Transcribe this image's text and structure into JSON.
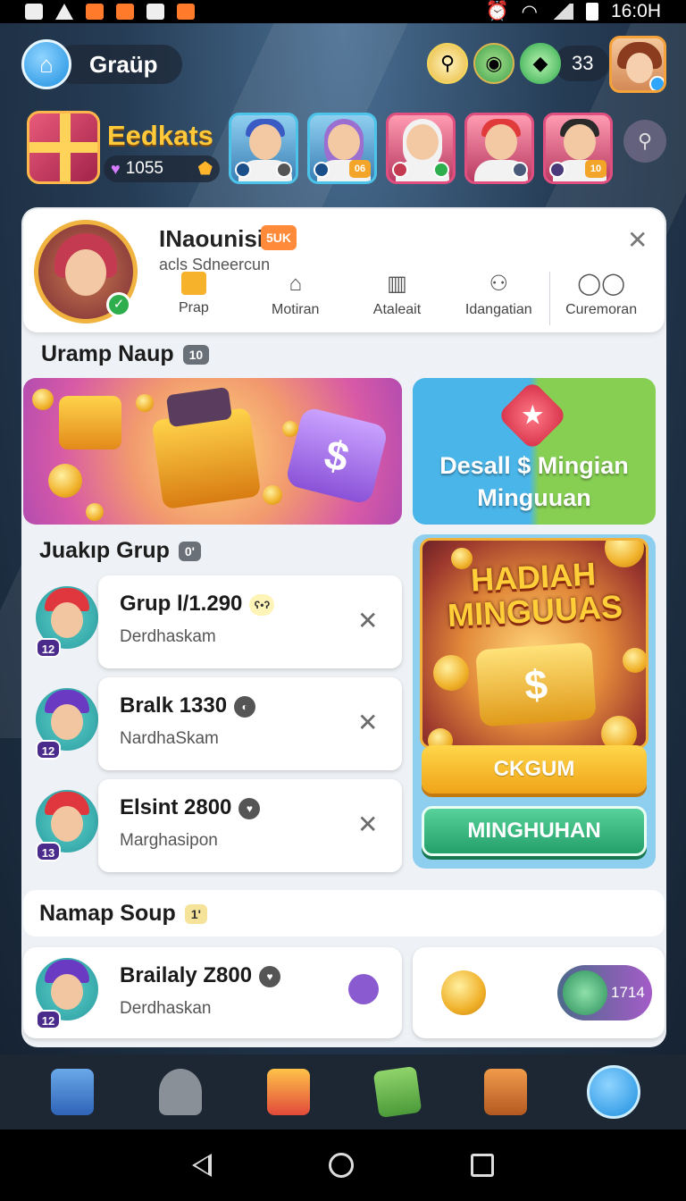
{
  "status_bar": {
    "time": "16:0H"
  },
  "header": {
    "title": "Graüp",
    "gem_count": "33"
  },
  "profile_strip": {
    "brand": "Eedkats",
    "coins": "1055",
    "friends": [
      {
        "level": ""
      },
      {
        "level": "06"
      },
      {
        "level": ""
      },
      {
        "level": ""
      },
      {
        "level": "10"
      }
    ]
  },
  "profile": {
    "name": "INaounisi",
    "tag": "5UK",
    "subtitle": "acls Sdneercun",
    "tabs": [
      {
        "label": "Prap",
        "icon": "gold-card-icon"
      },
      {
        "label": "Motiran",
        "icon": "home-icon"
      },
      {
        "label": "Ataleait",
        "icon": "building-icon"
      },
      {
        "label": "Idangatian",
        "icon": "users-icon"
      },
      {
        "label": "Curemoran",
        "icon": "chat-icon"
      }
    ]
  },
  "section_urampnaup": {
    "title": "Uramp Naup",
    "badge": "10"
  },
  "promo": {
    "weekly_text": "Desall $ Mingian Minguuan"
  },
  "section_juakip": {
    "title": "Juakıp Grup",
    "badge": "0'"
  },
  "groups": [
    {
      "name": "Grup l/1.290",
      "sub": "Derdhaskam",
      "level": "12"
    },
    {
      "name": "Bralk 1330",
      "sub": "NardhaSkam",
      "level": "12"
    },
    {
      "name": "Elsint 2800",
      "sub": "Marghasipon",
      "level": "13"
    }
  ],
  "reward": {
    "title": "HADIAH MINGUUAS",
    "button_primary": "CKGUM",
    "button_secondary": "MINGHUHAN"
  },
  "section_namap": {
    "title": "Namap Soup",
    "badge": "1'"
  },
  "bottom_group": {
    "name": "Brailaly Z800",
    "sub": "Derdhaskan",
    "level": "12"
  },
  "bottom_pill": {
    "value": "1714"
  },
  "nav": [
    {
      "icon": "list-icon"
    },
    {
      "icon": "search-badge-icon"
    },
    {
      "icon": "cards-icon"
    },
    {
      "icon": "card-pack-icon"
    },
    {
      "icon": "gift-box-icon"
    },
    {
      "icon": "profile-icon"
    }
  ]
}
